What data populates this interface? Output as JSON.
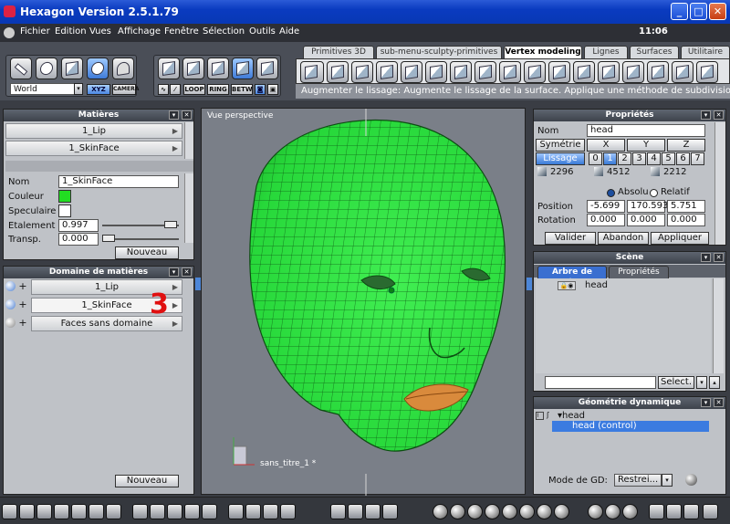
{
  "window": {
    "title": "Hexagon Version 2.5.1.79",
    "minimize": "_",
    "maximize": "□",
    "close": "✕"
  },
  "menu": [
    "Fichier",
    "Edition",
    "Vues",
    "Affichage",
    "Fenêtre",
    "Sélection",
    "Outils",
    "Aide"
  ],
  "clock": "11:06",
  "toolbar": {
    "coord_select": "World",
    "xyz": "XYZ",
    "camera": "CAMERA",
    "sel_modes": [
      "LOOP",
      "RING",
      "BETW"
    ]
  },
  "tabs": [
    "Primitives 3D",
    "sub-menu-sculpty-primitives",
    "Vertex modeling",
    "Lignes",
    "Surfaces",
    "Utilitaire"
  ],
  "active_tab": "Vertex modeling",
  "status": "Augmenter le lissage: Augmente le lissage de la surface. Applique une méthode de subdivisio",
  "materials": {
    "title": "Matières",
    "items": [
      "1_Lip",
      "1_SkinFace"
    ],
    "nom_label": "Nom",
    "nom_value": "1_SkinFace",
    "couleur_label": "Couleur",
    "couleur": "#22dd22",
    "speculaire_label": "Speculaire",
    "etalement_label": "Etalement",
    "etalement_value": "0.997",
    "transp_label": "Transp.",
    "transp_value": "0.000",
    "new_button": "Nouveau"
  },
  "domain": {
    "title": "Domaine de matières",
    "items": [
      "1_Lip",
      "1_SkinFace",
      "Faces sans domaine"
    ],
    "marker": "3",
    "new_button": "Nouveau"
  },
  "viewport": {
    "label": "Vue perspective",
    "scene_name": "sans_titre_1 *"
  },
  "properties": {
    "title": "Propriétés",
    "nom_label": "Nom",
    "nom_value": "head",
    "symmetry": "Symétrie",
    "axes": [
      "X",
      "Y",
      "Z"
    ],
    "smoothing": "Lissage",
    "levels": [
      "0",
      "1",
      "2",
      "3",
      "4",
      "5",
      "6",
      "7"
    ],
    "counts": [
      "2296",
      "4512",
      "2212"
    ],
    "absolu": "Absolu",
    "relatif": "Relatif",
    "position_label": "Position",
    "position": [
      "-5.699",
      "170.593",
      "5.751"
    ],
    "rotation_label": "Rotation",
    "rotation": [
      "0.000",
      "0.000",
      "0.000"
    ],
    "buttons": [
      "Valider",
      "Abandon",
      "Appliquer"
    ]
  },
  "scene": {
    "title": "Scène",
    "tabs": [
      "Arbre de scène",
      "Propriétés"
    ],
    "item": "head",
    "select_button": "Select."
  },
  "geometry": {
    "title": "Géométrie dynamique",
    "items": [
      "head",
      "head (control)"
    ],
    "mode_label": "Mode de GD:",
    "mode_value": "Restrei..."
  },
  "colors": {
    "mesh": "#27d83a",
    "lips": "#d98a3c",
    "accent": "#3f7bd8"
  }
}
